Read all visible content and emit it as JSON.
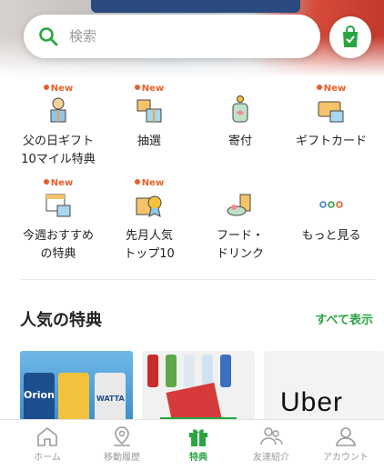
{
  "search": {
    "placeholder": "検索"
  },
  "quick_menu": [
    {
      "label": "父の日ギフト\n10マイル特典",
      "is_new": true,
      "new_text": "New",
      "icon": "gift-person-icon"
    },
    {
      "label": "抽選",
      "is_new": true,
      "new_text": "New",
      "icon": "gift-boxes-icon"
    },
    {
      "label": "寄付",
      "is_new": false,
      "icon": "donation-jar-icon"
    },
    {
      "label": "ギフトカード",
      "is_new": true,
      "new_text": "New",
      "icon": "gift-card-icon"
    },
    {
      "label": "今週おすすめ\nの特典",
      "is_new": true,
      "new_text": "New",
      "icon": "calendar-gift-icon"
    },
    {
      "label": "先月人気\nトップ10",
      "is_new": true,
      "new_text": "New",
      "icon": "ranking-gift-icon"
    },
    {
      "label": "フード・\nドリンク",
      "is_new": false,
      "icon": "food-drink-icon"
    },
    {
      "label": "もっと見る",
      "is_new": false,
      "icon": "more-dots-icon"
    }
  ],
  "popular": {
    "title": "人気の特典",
    "see_all": "すべて表示",
    "cards": [
      {
        "brand": "Orion",
        "sub": "WATTA"
      },
      {
        "brand": ""
      },
      {
        "brand": "Uber"
      }
    ]
  },
  "bottom_nav": [
    {
      "label": "ホーム",
      "icon": "home-icon",
      "active": false
    },
    {
      "label": "移動履歴",
      "icon": "location-history-icon",
      "active": false
    },
    {
      "label": "特典",
      "icon": "gift-icon",
      "active": true
    },
    {
      "label": "友達紹介",
      "icon": "friends-icon",
      "active": false
    },
    {
      "label": "アカウント",
      "icon": "account-icon",
      "active": false
    }
  ],
  "colors": {
    "accent": "#2aa640",
    "new_badge": "#e8602c"
  }
}
